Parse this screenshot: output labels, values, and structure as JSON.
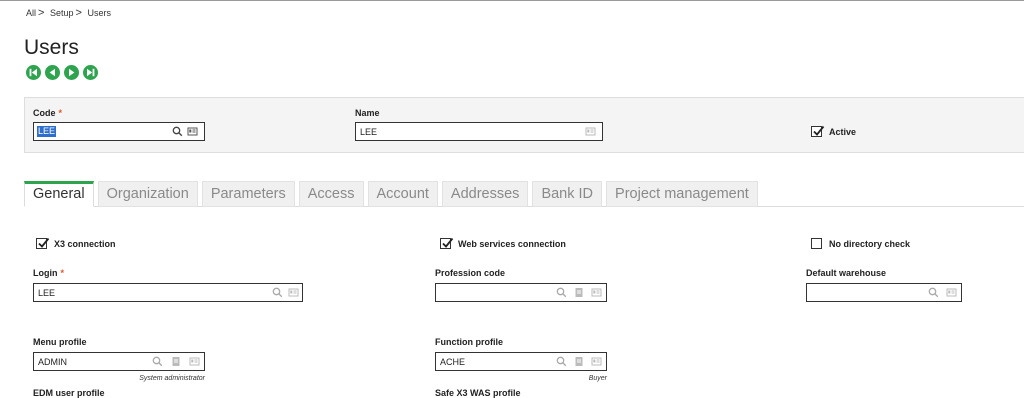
{
  "breadcrumb": {
    "items": [
      "All",
      "Setup",
      "Users"
    ]
  },
  "page": {
    "title": "Users"
  },
  "header": {
    "code_label": "Code",
    "code_value": "LEE",
    "name_label": "Name",
    "name_value": "LEE",
    "active_label": "Active",
    "active_checked": true
  },
  "tabs": [
    {
      "label": "General",
      "active": true
    },
    {
      "label": "Organization",
      "active": false
    },
    {
      "label": "Parameters",
      "active": false
    },
    {
      "label": "Access",
      "active": false
    },
    {
      "label": "Account",
      "active": false
    },
    {
      "label": "Addresses",
      "active": false
    },
    {
      "label": "Bank ID",
      "active": false
    },
    {
      "label": "Project management",
      "active": false
    }
  ],
  "general": {
    "x3_connection_label": "X3 connection",
    "x3_connection_checked": true,
    "web_services_label": "Web services connection",
    "web_services_checked": true,
    "no_directory_label": "No directory check",
    "no_directory_checked": false,
    "login_label": "Login",
    "login_value": "LEE",
    "profession_code_label": "Profession code",
    "profession_code_value": "",
    "default_warehouse_label": "Default warehouse",
    "default_warehouse_value": "",
    "menu_profile_label": "Menu profile",
    "menu_profile_value": "ADMIN",
    "menu_profile_desc": "System administrator",
    "function_profile_label": "Function profile",
    "function_profile_value": "ACHE",
    "function_profile_desc": "Buyer",
    "edm_profile_label": "EDM user profile",
    "safe_x3_label": "Safe X3 WAS profile"
  },
  "colors": {
    "accent_green": "#2ea44f",
    "required_star": "#e8542a",
    "selection": "#2f6fcc"
  }
}
